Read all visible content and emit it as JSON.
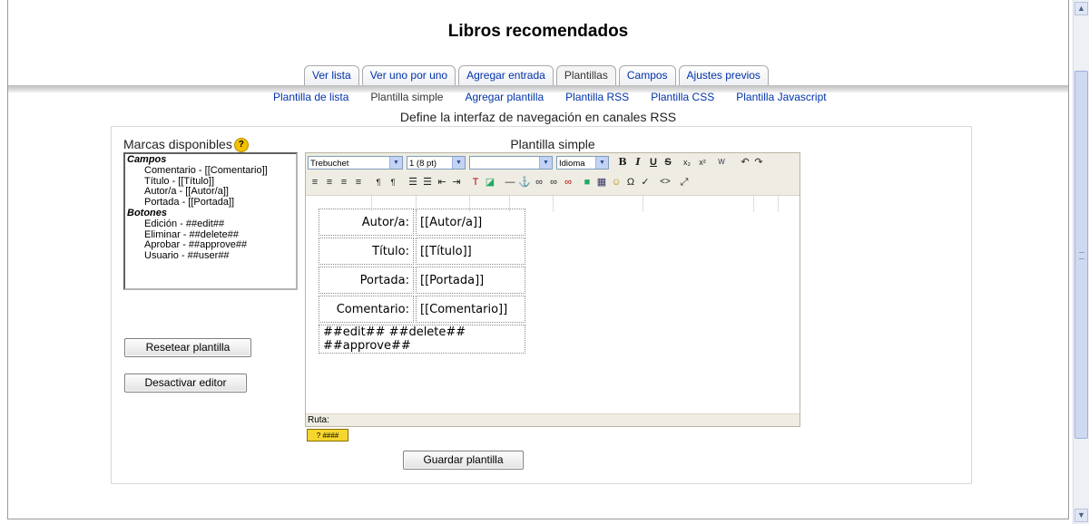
{
  "page": {
    "title": "Libros recomendados"
  },
  "tabs": [
    {
      "label": "Ver lista"
    },
    {
      "label": "Ver uno por uno"
    },
    {
      "label": "Agregar entrada"
    },
    {
      "label": "Plantillas"
    },
    {
      "label": "Campos"
    },
    {
      "label": "Ajustes previos"
    }
  ],
  "subtabs": [
    {
      "label": "Plantilla de lista"
    },
    {
      "label": "Plantilla simple"
    },
    {
      "label": "Agregar plantilla"
    },
    {
      "label": "Plantilla RSS"
    },
    {
      "label": "Plantilla CSS"
    },
    {
      "label": "Plantilla Javascript"
    }
  ],
  "heading": "Define la interfaz de navegación en canales RSS",
  "marcas": {
    "label": "Marcas disponibles",
    "help_glyph": "?",
    "groups": [
      {
        "name": "Campos",
        "items": [
          "Comentario - [[Comentario]]",
          "Título - [[Título]]",
          "Autor/a - [[Autor/a]]",
          "Portada - [[Portada]]"
        ]
      },
      {
        "name": "Botones",
        "items": [
          "Edición - ##edit##",
          "Eliminar - ##delete##",
          "Aprobar - ##approve##",
          "Usuario - ##user##"
        ]
      }
    ]
  },
  "buttons": {
    "reset": "Resetear plantilla",
    "disable_editor": "Desactivar editor",
    "save": "Guardar plantilla"
  },
  "editor": {
    "title": "Plantilla simple",
    "font_family": "Trebuchet",
    "font_size": "1 (8 pt)",
    "format": "",
    "language": "Idioma",
    "path_label": "Ruta:",
    "rows": [
      {
        "label": "Autor/a:",
        "value": "[[Autor/a]]"
      },
      {
        "label": "Título:",
        "value": "[[Título]]"
      },
      {
        "label": "Portada:",
        "value": "[[Portada]]"
      },
      {
        "label": "Comentario:",
        "value": "[[Comentario]]"
      }
    ],
    "footer_row": "##edit## ##delete## ##approve##"
  },
  "colors": {
    "link": "#0033aa",
    "toolbar_bg": "#efede3",
    "help": "#f2c200"
  }
}
